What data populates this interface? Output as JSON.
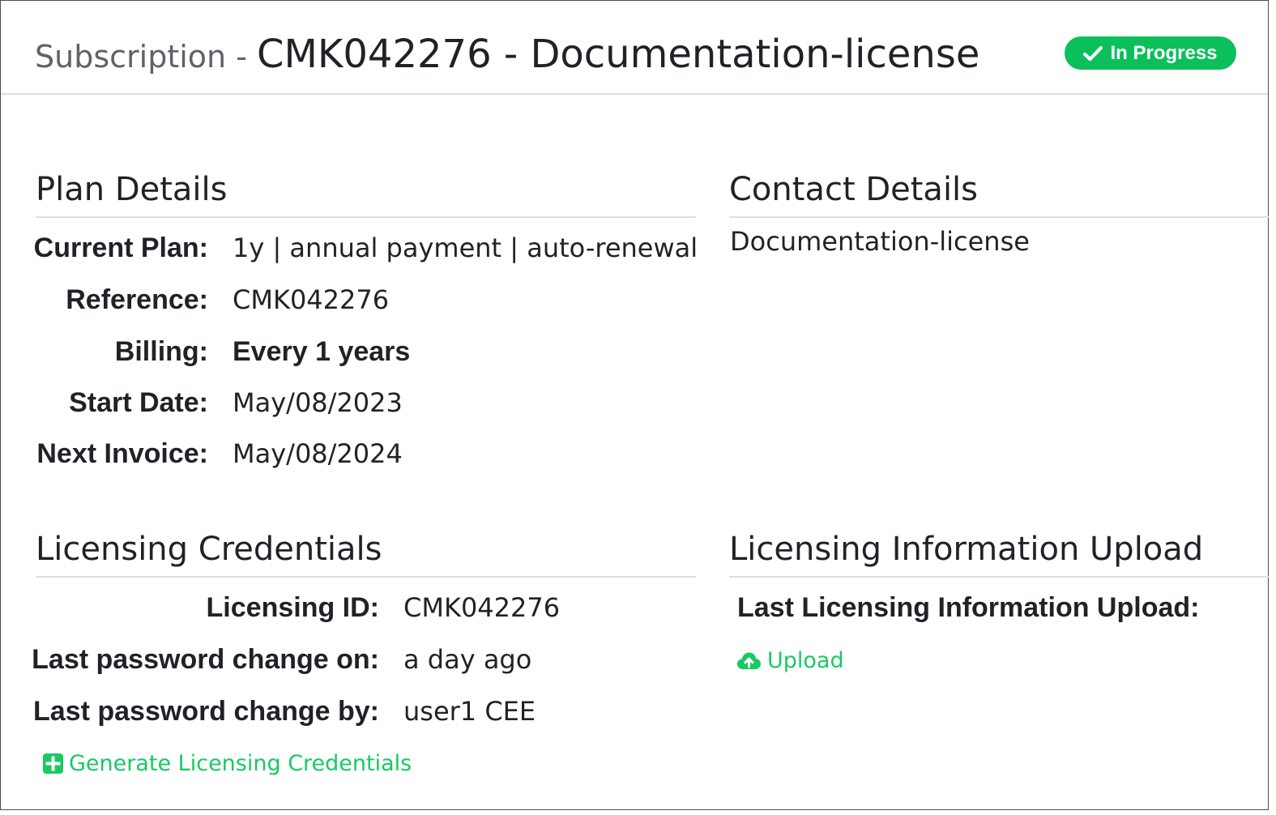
{
  "header": {
    "title_prefix": "Subscription - ",
    "title_main": "CMK042276 - Documentation-license",
    "status_badge": "In Progress",
    "status_icon": "check-icon",
    "status_color": "#0bbf5a"
  },
  "plan_details": {
    "title": "Plan Details",
    "rows": [
      {
        "label": "Current Plan:",
        "value": "1y | annual payment | auto-renewal"
      },
      {
        "label": "Reference:",
        "value": "CMK042276"
      },
      {
        "label": "Billing:",
        "value": "Every 1 years"
      },
      {
        "label": "Start Date:",
        "value": "May/08/2023"
      },
      {
        "label": "Next Invoice:",
        "value": "May/08/2024"
      }
    ]
  },
  "contact_details": {
    "title": "Contact Details",
    "name": "Documentation-license"
  },
  "licensing_credentials": {
    "title": "Licensing Credentials",
    "rows": [
      {
        "label": "Licensing ID:",
        "value": "CMK042276"
      },
      {
        "label": "Last password change on:",
        "value": "a day ago"
      },
      {
        "label": "Last password change by:",
        "value": "user1 CEE"
      }
    ],
    "generate_link": "Generate Licensing Credentials",
    "generate_icon": "plus-square-icon"
  },
  "licensing_upload": {
    "title": "Licensing Information Upload",
    "last_upload_label": "Last Licensing Information Upload:",
    "upload_link": "Upload",
    "upload_icon": "cloud-upload-icon"
  },
  "accent_color": "#18c964"
}
